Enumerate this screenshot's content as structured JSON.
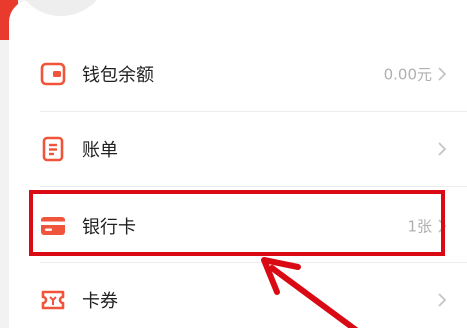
{
  "menu": {
    "items": [
      {
        "label": "钱包余额",
        "value": "0.00元",
        "icon": "wallet-icon"
      },
      {
        "label": "账单",
        "value": "",
        "icon": "bill-icon"
      },
      {
        "label": "银行卡",
        "value": "1张",
        "icon": "bank-card-icon"
      },
      {
        "label": "卡券",
        "value": "",
        "icon": "coupon-icon"
      }
    ]
  },
  "colors": {
    "accent": "#f0553c",
    "annotation": "#d90a14",
    "header_red": "#e83b2e",
    "text": "#222222",
    "muted": "#b0b0b0"
  }
}
